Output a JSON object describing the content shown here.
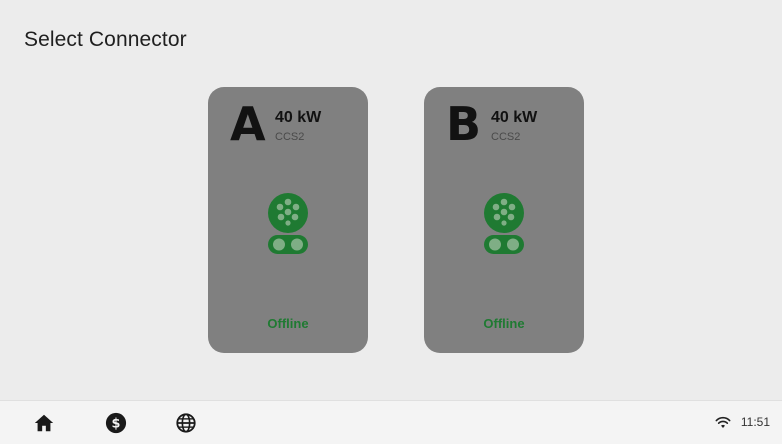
{
  "page": {
    "title": "Select Connector"
  },
  "connectors": [
    {
      "letter": "A",
      "power": "40 kW",
      "type": "CCS2",
      "status": "Offline",
      "status_color": "#1f7a32"
    },
    {
      "letter": "B",
      "power": "40 kW",
      "type": "CCS2",
      "status": "Offline",
      "status_color": "#1f7a32"
    }
  ],
  "bottom_bar": {
    "icons": [
      "home-icon",
      "dollar-icon",
      "globe-icon"
    ],
    "wifi_icon": "wifi-icon",
    "time": "11:51"
  },
  "colors": {
    "card_bg": "#808080",
    "connector_icon": "#1f7a32",
    "background": "#ececec"
  }
}
